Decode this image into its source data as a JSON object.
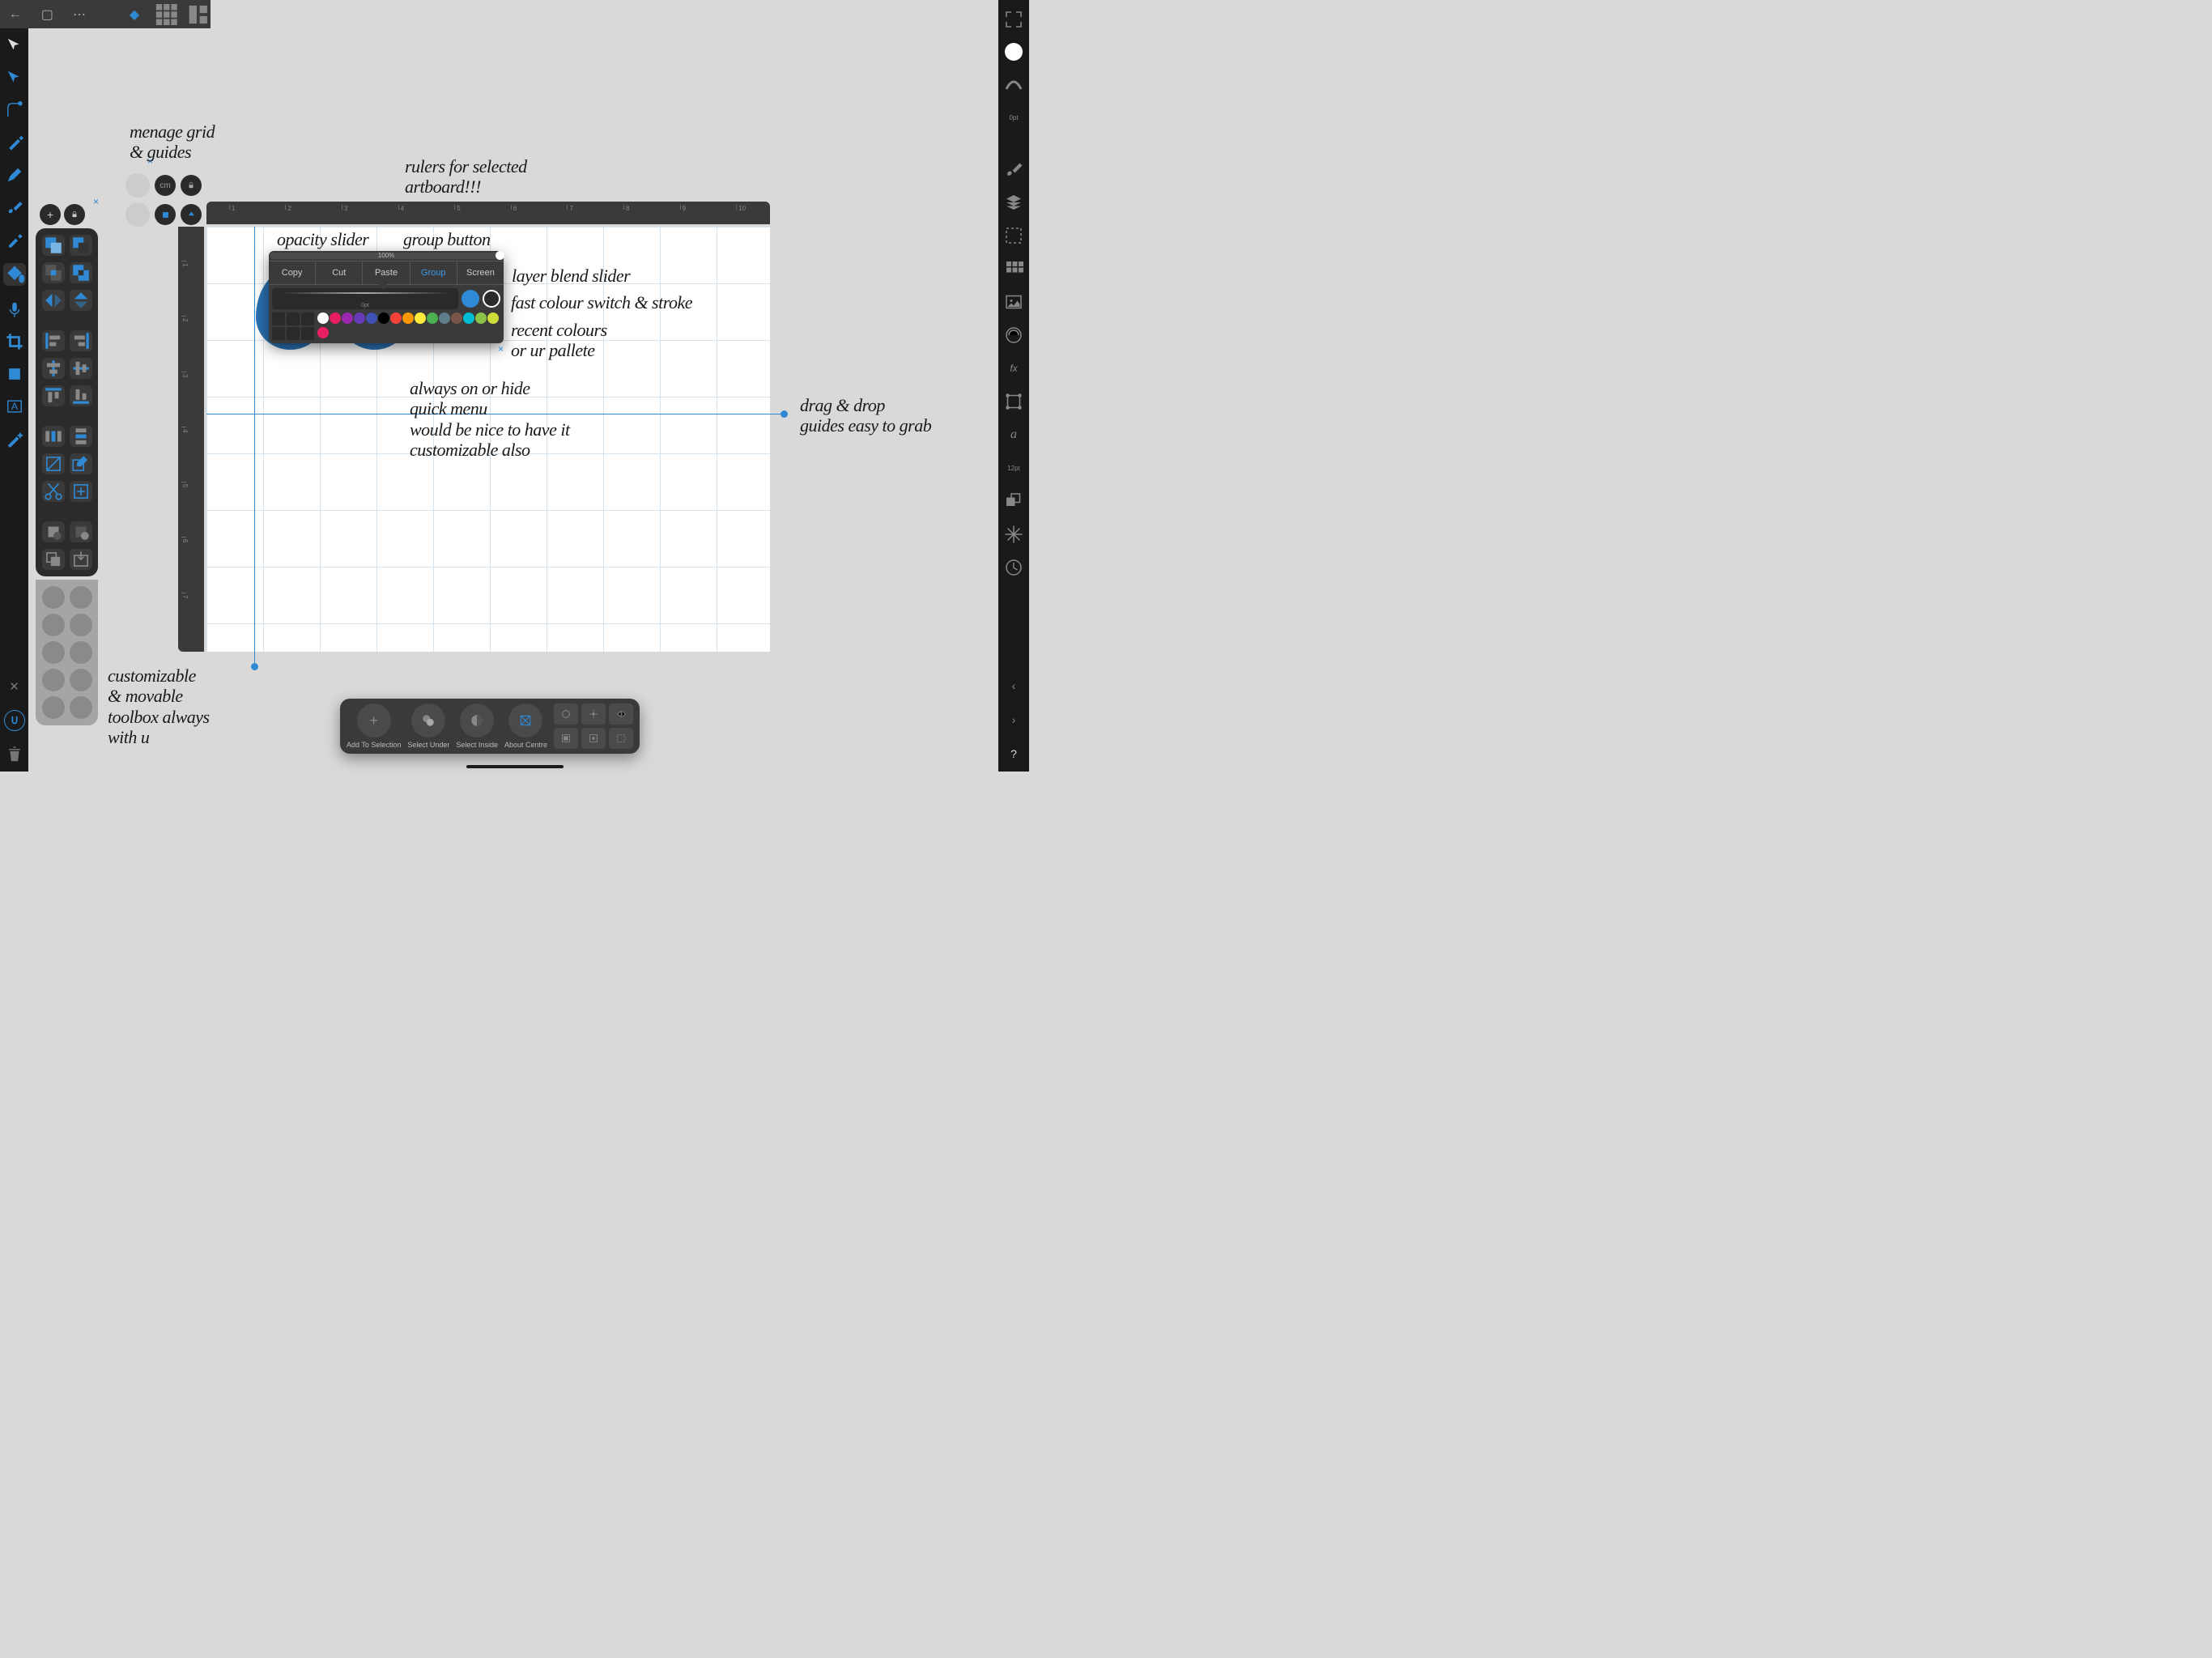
{
  "top": {
    "back": "←",
    "doc": "▢",
    "more": "⋯",
    "logo": "⬟",
    "grid": "⊞",
    "studio": "▦"
  },
  "left_tools": [
    "move",
    "node",
    "corner",
    "pen",
    "pencil",
    "brush",
    "drop",
    "fill",
    "audio",
    "crop",
    "shape",
    "text",
    "wand"
  ],
  "right": {
    "stroke_width": "0pt",
    "font_size": "12pt"
  },
  "grid_panel": {
    "unit": "cm",
    "lock": "🔒"
  },
  "toolbox": {
    "rows": [
      [
        "union",
        "subtract"
      ],
      [
        "intersect",
        "xor"
      ],
      [
        "flip-h",
        "flip-v"
      ],
      [
        "",
        ""
      ],
      [
        "align-l",
        "align-c",
        "align-r"
      ],
      [
        "align-t",
        "align-m",
        "align-b"
      ],
      [
        "",
        "",
        ""
      ],
      [
        "dist-h",
        "dist-v"
      ],
      [
        "",
        "",
        ""
      ],
      [
        "cut",
        "edit"
      ],
      [
        "dup",
        "del"
      ],
      [
        "front",
        "back"
      ]
    ]
  },
  "qmenu": {
    "opacity_label": "100%",
    "btns": [
      "Copy",
      "Cut",
      "Paste",
      "Group",
      "Screen"
    ],
    "brush_label": "0pt",
    "palette": [
      "#ffffff",
      "#e81e63",
      "#9c27b0",
      "#673ab7",
      "#3f51b5",
      "#000000",
      "#f44336",
      "#ff9800",
      "#ffeb3b",
      "#4caf50",
      "#607d8b",
      "#795548",
      "#00bcd4",
      "#8bc34a",
      "#cddc39",
      "#e91e63"
    ],
    "ops": [
      "add",
      "sub",
      "int",
      "xor",
      "div",
      "comb"
    ]
  },
  "sel_opts": {
    "items": [
      {
        "icon": "+",
        "label": "Add To Selection"
      },
      {
        "icon": "●",
        "label": "Select Under"
      },
      {
        "icon": "◐",
        "label": "Select Inside"
      },
      {
        "icon": "▧",
        "label": "About Centre"
      }
    ]
  },
  "annotations": {
    "grid": "menage grid\n& guides",
    "rulers": "rulers for selected\nartboard!!!",
    "opacity": "opacity slider",
    "group": "group button",
    "blend": "layer blend slider",
    "colsw": "fast colour switch & stroke",
    "pal": "recent colours\nor ur pallete",
    "menu": "always on or hide\nquick menu\nwould be nice to have it\ncustomizable also",
    "guides": "drag & drop\nguides easy to grab",
    "toolbox": "customizable\n& movable\ntoolbox always\nwith u"
  }
}
